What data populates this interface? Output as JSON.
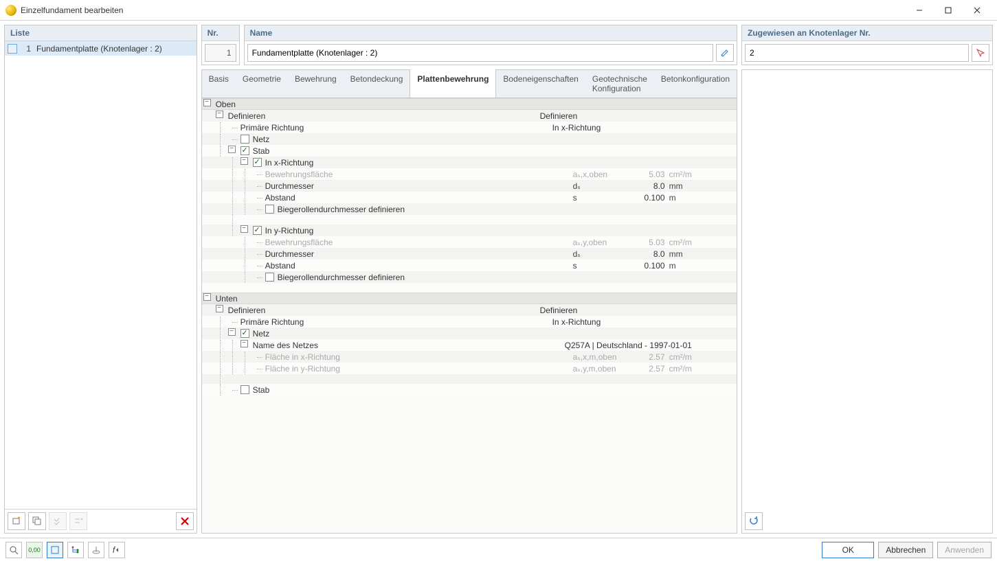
{
  "window": {
    "title": "Einzelfundament bearbeiten"
  },
  "sidebar": {
    "heading": "Liste",
    "items": [
      {
        "index": "1",
        "label": "Fundamentplatte (Knotenlager : 2)"
      }
    ]
  },
  "header": {
    "nr_label": "Nr.",
    "nr_value": "1",
    "name_label": "Name",
    "name_value": "Fundamentplatte (Knotenlager : 2)",
    "assign_label": "Zugewiesen an Knotenlager Nr.",
    "assign_value": "2"
  },
  "tabs": [
    {
      "label": "Basis"
    },
    {
      "label": "Geometrie"
    },
    {
      "label": "Bewehrung"
    },
    {
      "label": "Betondeckung"
    },
    {
      "label": "Plattenbewehrung",
      "active": true
    },
    {
      "label": "Bodeneigenschaften"
    },
    {
      "label": "Geotechnische Konfiguration"
    },
    {
      "label": "Betonkonfiguration"
    }
  ],
  "tree": {
    "oben": "Oben",
    "definieren": "Definieren",
    "definieren_val": "Definieren",
    "prim_richtung": "Primäre Richtung",
    "in_x_richtung": "In x-Richtung",
    "netz": "Netz",
    "stab": "Stab",
    "in_y_richtung": "In y-Richtung",
    "bewehrungsflaeche": "Bewehrungsfläche",
    "durchmesser": "Durchmesser",
    "abstand": "Abstand",
    "biegeroll": "Biegerollendurchmesser definieren",
    "unten": "Unten",
    "name_netz": "Name des Netzes",
    "name_netz_val": "Q257A | Deutschland - 1997-01-01",
    "flaeche_x": "Fläche in x-Richtung",
    "flaeche_y": "Fläche in y-Richtung",
    "sym_asx_oben": "aₛ,x,oben",
    "sym_asy_oben": "aₛ,y,oben",
    "sym_asx_m_oben": "aₛ,x,m,oben",
    "sym_asy_m_oben": "aₛ,y,m,oben",
    "sym_ds": "dₛ",
    "sym_s": "s",
    "val_503": "5.03",
    "val_80": "8.0",
    "val_0100": "0.100",
    "val_257": "2.57",
    "unit_cm2m": "cm²/m",
    "unit_mm": "mm",
    "unit_m": "m"
  },
  "footer": {
    "ok": "OK",
    "cancel": "Abbrechen",
    "apply": "Anwenden"
  }
}
